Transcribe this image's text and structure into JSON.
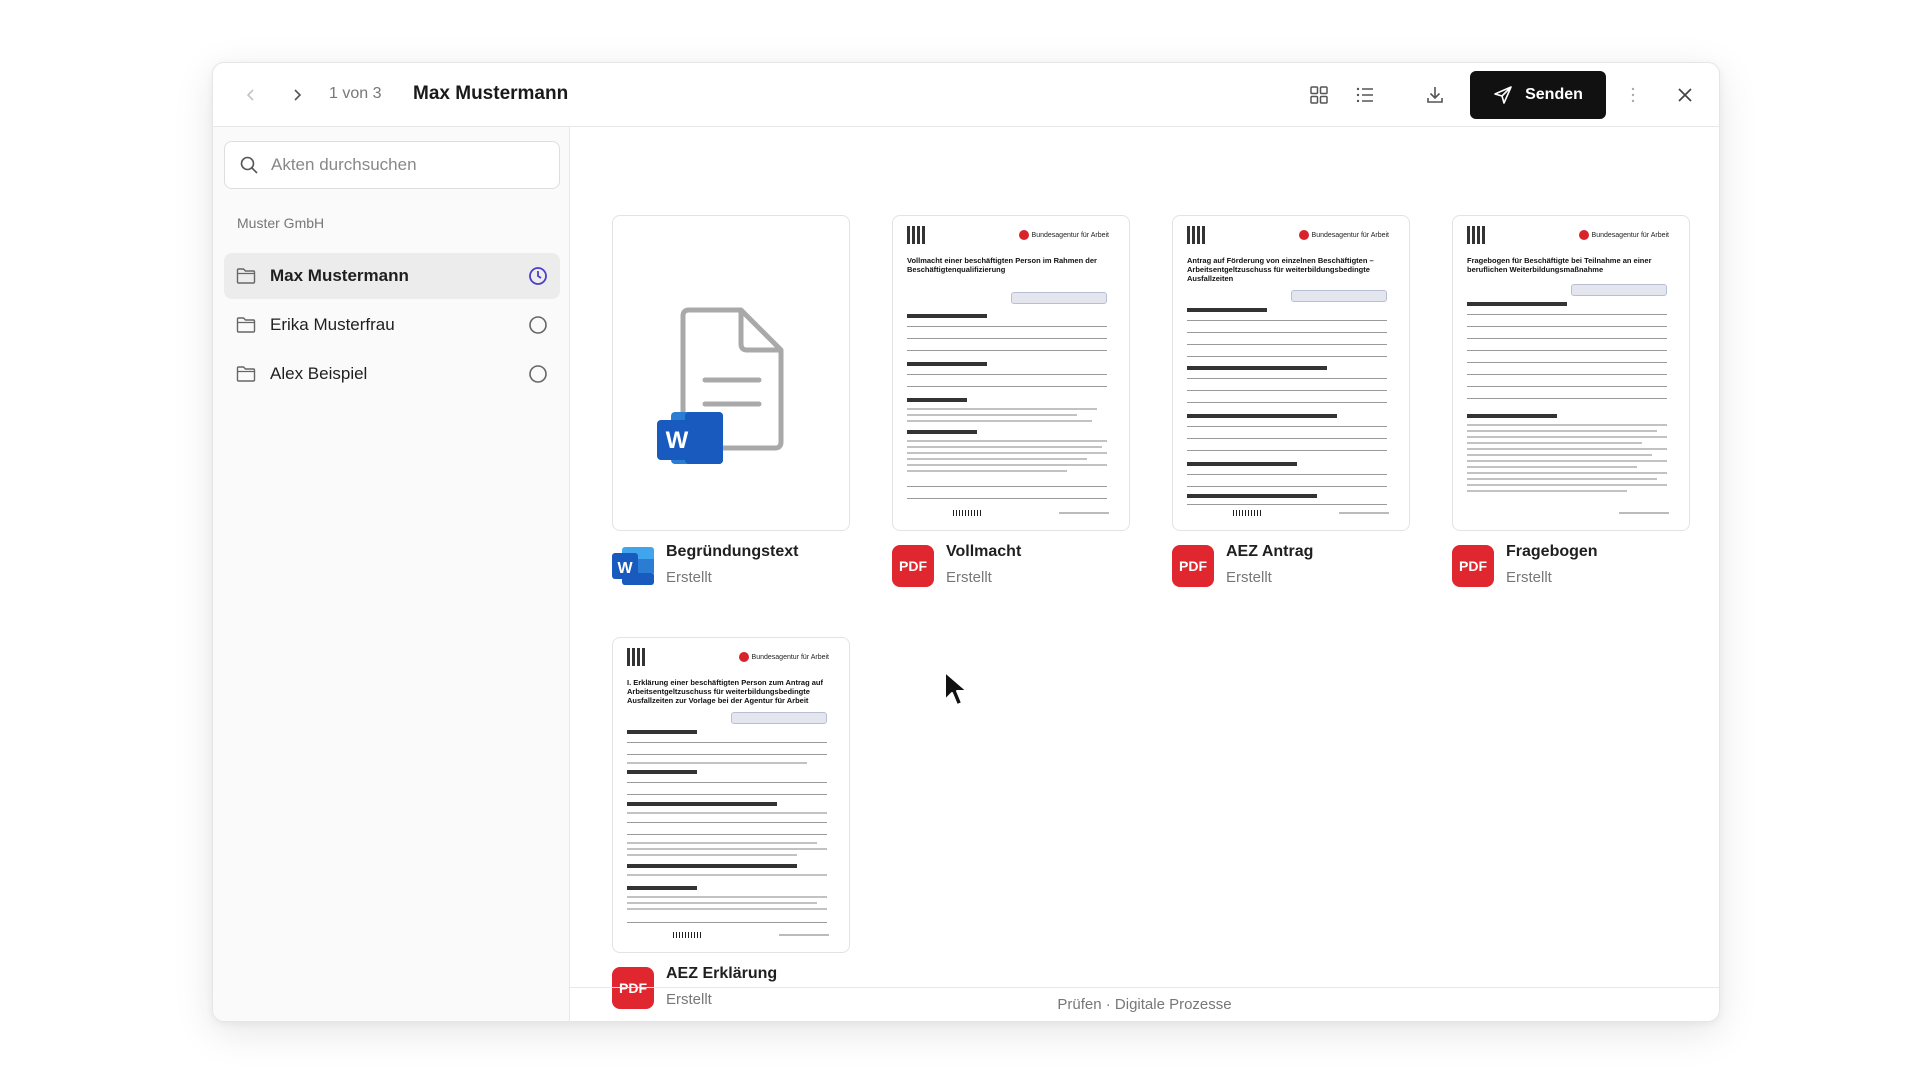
{
  "toolbar": {
    "counter": "1 von 3",
    "title": "Max Mustermann",
    "send_label": "Senden"
  },
  "sidebar": {
    "search_placeholder": "Akten durchsuchen",
    "group_label": "Muster GmbH",
    "items": [
      {
        "label": "Max Mustermann",
        "status": "in-progress"
      },
      {
        "label": "Erika Musterfrau",
        "status": "open"
      },
      {
        "label": "Alex Beispiel",
        "status": "open"
      }
    ]
  },
  "documents": [
    {
      "name": "Begründungstext",
      "status": "Erstellt",
      "type": "W"
    },
    {
      "name": "Vollmacht",
      "status": "Erstellt",
      "type": "PDF",
      "form_title": "Vollmacht einer beschäftigten Person im Rahmen der Beschäftigtenqualifizierung"
    },
    {
      "name": "AEZ Antrag",
      "status": "Erstellt",
      "type": "PDF",
      "form_title": "Antrag auf Förderung von einzelnen Beschäftigten – Arbeitsentgeltzuschuss für weiterbildungsbedingte Ausfallzeiten"
    },
    {
      "name": "Fragebogen",
      "status": "Erstellt",
      "type": "PDF",
      "form_title": "Fragebogen für Beschäftigte bei Teilnahme an einer beruflichen Weiterbildungsmaßnahme"
    },
    {
      "name": "AEZ Erklärung",
      "status": "Erstellt",
      "type": "PDF",
      "form_title": "I. Erklärung einer beschäftigten Person zum Antrag auf Arbeitsentgeltzuschuss für weiterbildungsbedingte Ausfallzeiten zur Vorlage bei der Agentur für Arbeit"
    }
  ],
  "form_brand": "Bundesagentur für Arbeit",
  "footer": "Prüfen · Digitale Prozesse",
  "colors": {
    "accent": "#4b3fc9",
    "pdf_red": "#e0262f",
    "word_blue": "#185abd",
    "send_bg": "#111111"
  }
}
